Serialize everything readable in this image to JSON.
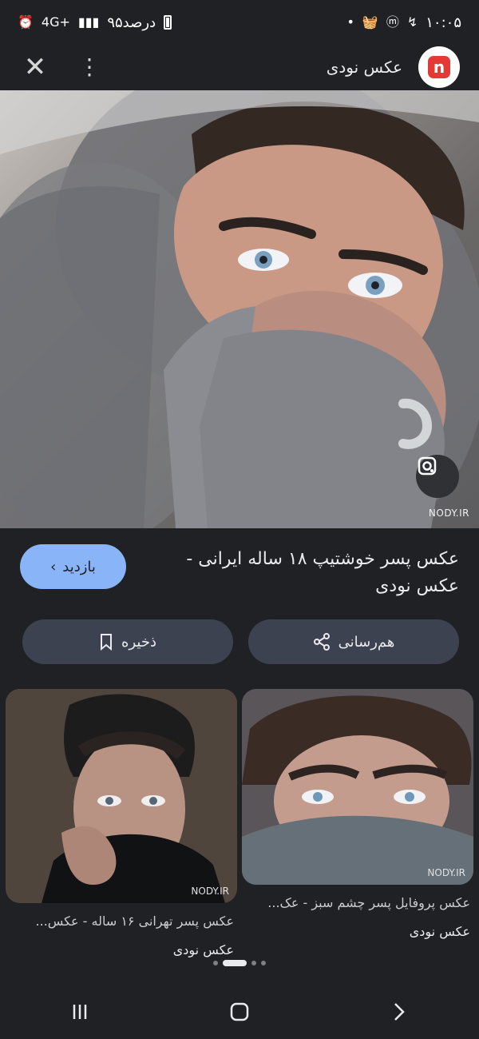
{
  "status_bar": {
    "time": "۱۰:۰۵",
    "battery_text": "۹۵درصد",
    "network": "4G+"
  },
  "header": {
    "site_name": "عکس نودی",
    "logo_letter": "n",
    "close_icon": "close-icon",
    "more_icon": "more-vertical-icon"
  },
  "image": {
    "watermark": "NODY.IR",
    "lens_icon": "google-lens-icon"
  },
  "result": {
    "title": "عکس پسر خوشتیپ ۱۸ ساله ایرانی - عکس نودی",
    "visit_label": "بازدید",
    "visit_icon": "chevron-right-icon"
  },
  "actions": {
    "save_label": "ذخیره",
    "share_label": "هم‌رسانی"
  },
  "related": [
    {
      "title": "عکس پسر تهرانی ۱۶ ساله - عکس...",
      "subtitle": "عکس نودی",
      "watermark": "NODY.IR"
    },
    {
      "title": "عکس پروفایل پسر چشم سبز - عک...",
      "subtitle": "عکس نودی",
      "watermark": "NODY.IR"
    }
  ],
  "pager": {
    "active_index": 1,
    "count": 4
  },
  "nav_bar": {
    "recent_apps_icon": "recent-apps-icon",
    "home_icon": "home-icon",
    "back_icon": "back-icon"
  },
  "colors": {
    "background": "#202124",
    "accent": "#8ab4f8",
    "button_bg": "#3c4250",
    "logo_red": "#e53935"
  }
}
